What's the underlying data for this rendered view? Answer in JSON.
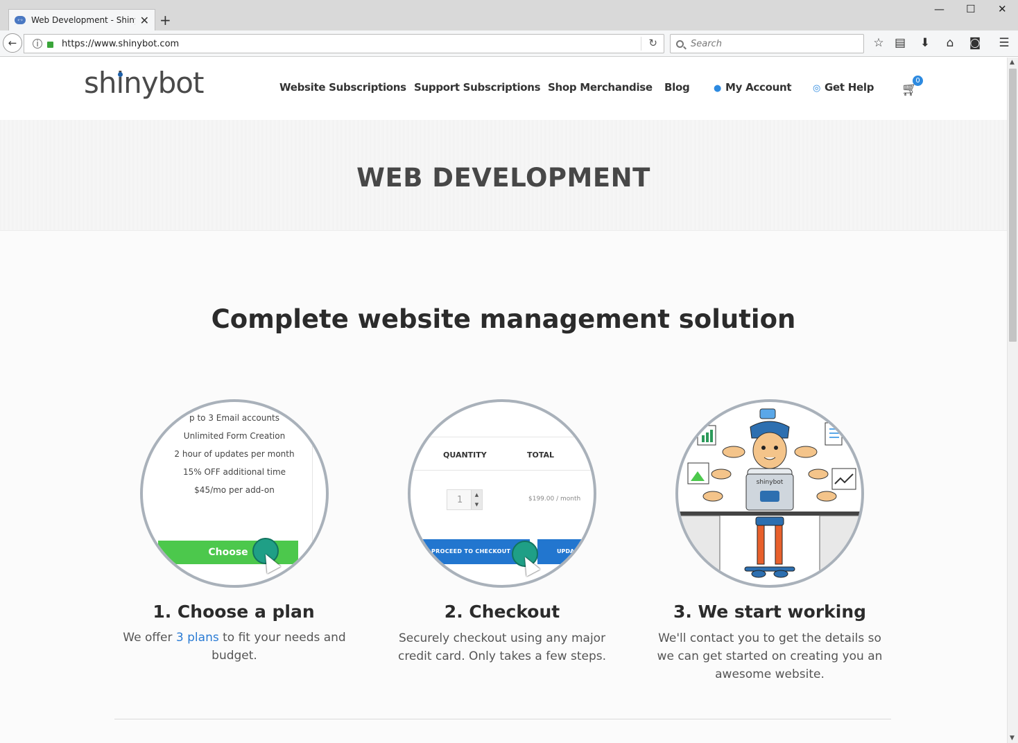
{
  "browser": {
    "tab_title": "Web Development - Shinybot",
    "url": "https://www.shinybot.com",
    "search_placeholder": "Search"
  },
  "site": {
    "logo_text": "shinybot",
    "nav": [
      {
        "label": "Website Subscriptions"
      },
      {
        "label": "Support Subscriptions"
      },
      {
        "label": "Shop Merchandise"
      },
      {
        "label": "Blog"
      },
      {
        "label": "My Account",
        "icon": "user-icon"
      },
      {
        "label": "Get Help",
        "icon": "lifebuoy-icon"
      }
    ],
    "cart_count": "0",
    "accent_color": "#2d8ae0"
  },
  "hero": {
    "title": "WEB DEVELOPMENT"
  },
  "main": {
    "section_title": "Complete website management solution",
    "steps": [
      {
        "title": "1. Choose a plan",
        "desc_before": "We offer ",
        "desc_link": "3 plans",
        "desc_after": " to fit your needs and budget."
      },
      {
        "title": "2. Checkout",
        "desc": "Securely checkout using any major credit card. Only takes a few steps."
      },
      {
        "title": "3. We start working",
        "desc": "We'll contact you to get the details so we can get started on creating you an awesome website."
      }
    ]
  },
  "plan_preview": {
    "features": [
      "p to 3 Email accounts",
      "Unlimited Form Creation",
      "2 hour of updates per month",
      "15% OFF additional time",
      "$45/mo per add-on"
    ],
    "button": "Choose",
    "button_color": "#4cc84c"
  },
  "checkout_preview": {
    "col_quantity": "QUANTITY",
    "col_total": "TOTAL",
    "quantity": "1",
    "price": "$199.00 / month",
    "checkout_button": "PROCEED TO CHECKOUT",
    "update_button": "UPDA"
  },
  "illustration": {
    "laptop_label": "shinybot"
  }
}
